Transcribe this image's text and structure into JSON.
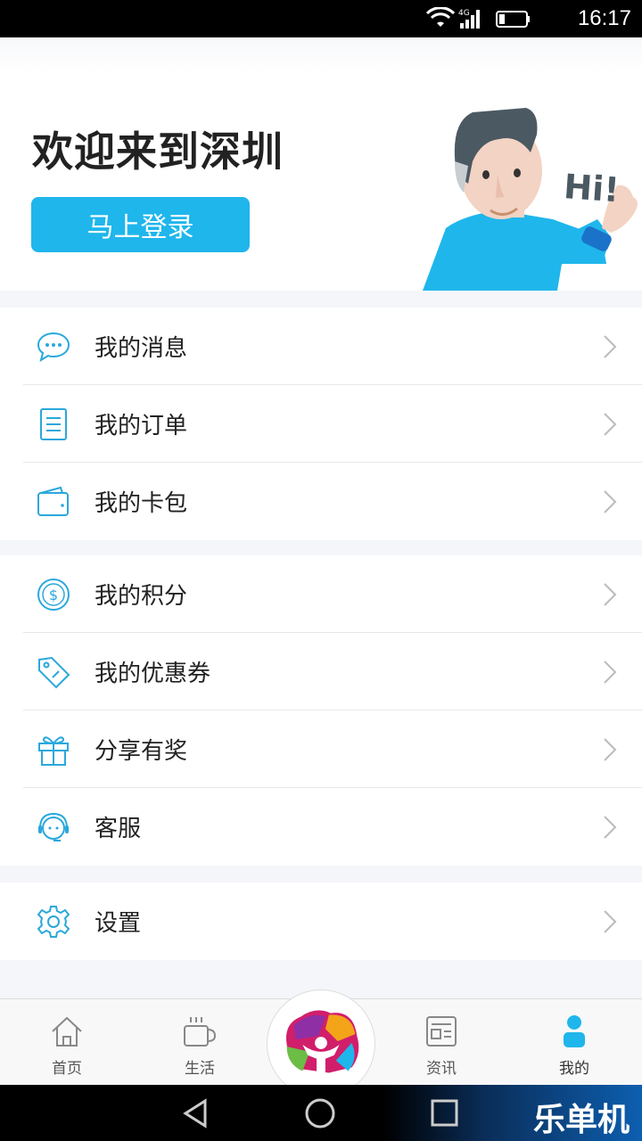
{
  "status_bar": {
    "time": "16:17",
    "network": "4G"
  },
  "header": {
    "welcome": "欢迎来到深圳",
    "login_button": "马上登录",
    "greeting": "Hi!"
  },
  "menu": {
    "group1": [
      {
        "label": "我的消息",
        "icon": "chat-bubble-icon"
      },
      {
        "label": "我的订单",
        "icon": "document-icon"
      },
      {
        "label": "我的卡包",
        "icon": "wallet-icon"
      }
    ],
    "group2": [
      {
        "label": "我的积分",
        "icon": "coin-icon"
      },
      {
        "label": "我的优惠券",
        "icon": "tag-icon"
      },
      {
        "label": "分享有奖",
        "icon": "gift-icon"
      },
      {
        "label": "客服",
        "icon": "headset-icon"
      }
    ],
    "group3": [
      {
        "label": "设置",
        "icon": "gear-icon"
      }
    ]
  },
  "tabbar": {
    "home": "首页",
    "life": "生活",
    "news": "资讯",
    "mine": "我的"
  },
  "navbar": {
    "watermark": "乐单机"
  },
  "colors": {
    "accent": "#1fb6ec",
    "icon": "#2aa8dc",
    "active_tab": "#1fb6ec"
  }
}
